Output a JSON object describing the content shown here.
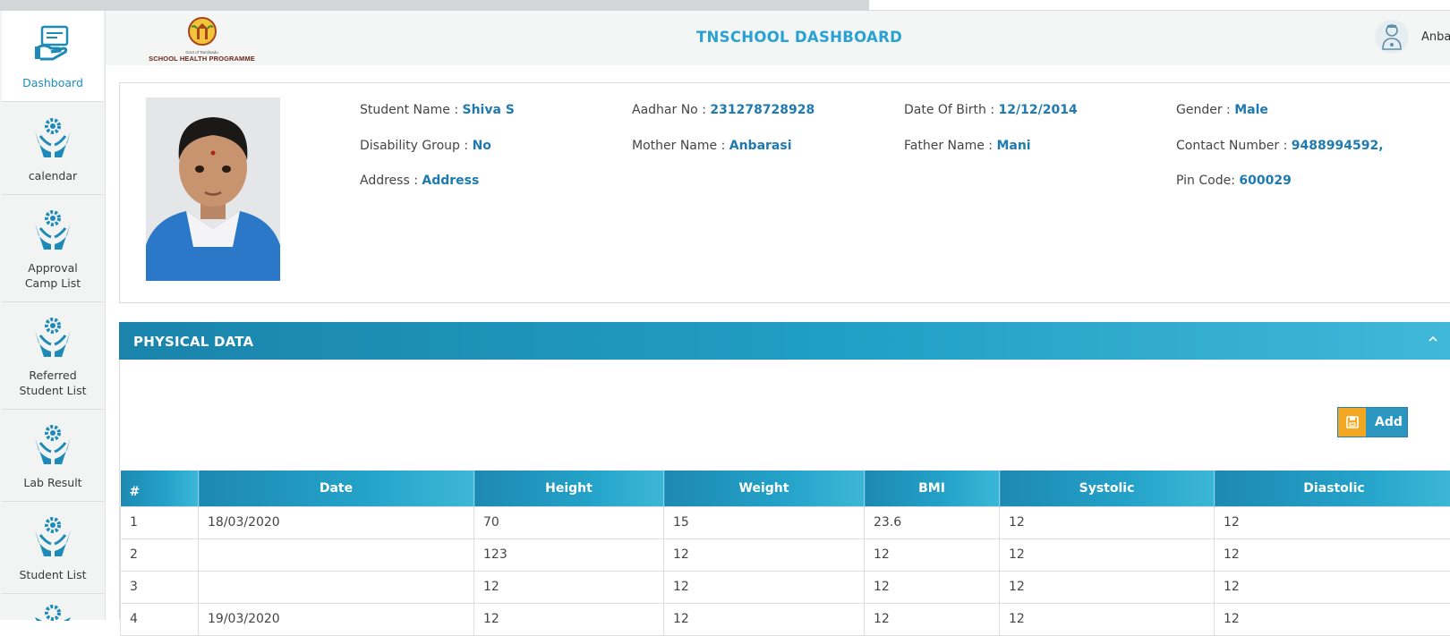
{
  "sidebar": {
    "items": [
      {
        "label": "Dashboard",
        "active": true
      },
      {
        "label": "calendar"
      },
      {
        "label": "Approval Camp List"
      },
      {
        "label": "Referred Student List"
      },
      {
        "label": "Lab Result"
      },
      {
        "label": "Student List"
      }
    ]
  },
  "header": {
    "logo_caption_top": "Govt of Tamilnadu",
    "logo_caption": "SCHOOL HEALTH PROGRAMME",
    "title": "TNSCHOOL DASHBOARD",
    "user_name": "Anba"
  },
  "student": {
    "name_label": "Student Name : ",
    "name": "Shiva S",
    "aadhar_label": "Aadhar No : ",
    "aadhar": "231278728928",
    "dob_label": "Date Of Birth : ",
    "dob": "12/12/2014",
    "gender_label": "Gender : ",
    "gender": "Male",
    "disability_label": "Disability Group : ",
    "disability": "No",
    "mother_label": "Mother Name : ",
    "mother": "Anbarasi",
    "father_label": "Father Name : ",
    "father": "Mani",
    "contact_label": "Contact Number : ",
    "contact": "9488994592,",
    "address_label": "Address : ",
    "address": "Address",
    "pin_label": "Pin Code: ",
    "pin": "600029"
  },
  "physical": {
    "title": "PHYSICAL DATA",
    "add_label": "Add",
    "columns": [
      "#",
      "Date",
      "Height",
      "Weight",
      "BMI",
      "Systolic",
      "Diastolic"
    ],
    "rows": [
      [
        "1",
        "18/03/2020",
        "70",
        "15",
        "23.6",
        "12",
        "12"
      ],
      [
        "2",
        "",
        "123",
        "12",
        "12",
        "12",
        "12"
      ],
      [
        "3",
        "",
        "12",
        "12",
        "12",
        "12",
        "12"
      ],
      [
        "4",
        "19/03/2020",
        "12",
        "12",
        "12",
        "12",
        "12"
      ]
    ]
  },
  "colors": {
    "accent": "#1e7ab0",
    "header_bar": "#219fc4",
    "add_icon": "#f2a822",
    "title": "#27a2d3"
  },
  "icons": {
    "sidebar_dashboard": "hand-certificate-icon",
    "sidebar_other": "hands-gear-icon",
    "add": "save-icon",
    "collapse": "chevron-up-icon"
  }
}
